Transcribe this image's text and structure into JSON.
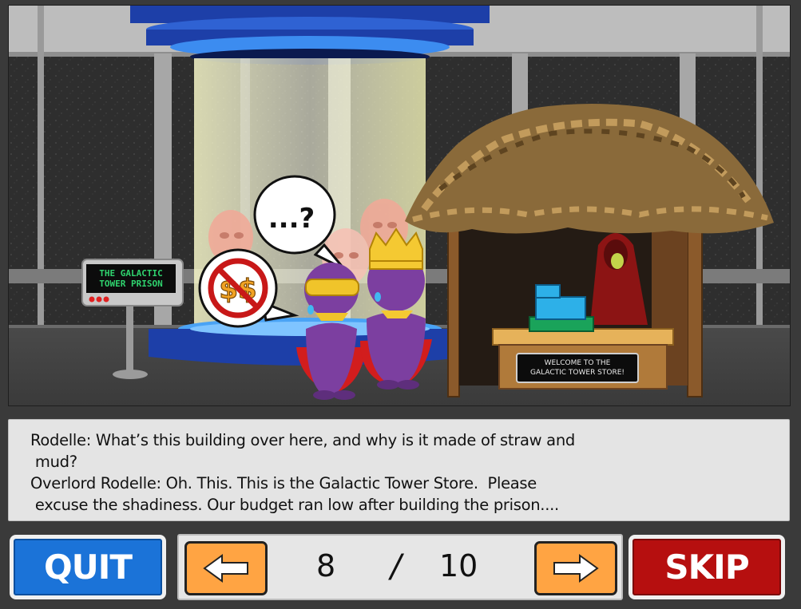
{
  "scene": {
    "prison_sign": [
      "THE GALACTIC",
      "TOWER PRISON"
    ],
    "thought_bubble": "...?",
    "store_sign": [
      "WELCOME TO THE",
      "GALACTIC TOWER STORE!"
    ]
  },
  "dialogue": {
    "lines": [
      "Rodelle: What’s this building over here, and why is it made of straw and",
      " mud?",
      "Overlord Rodelle: Oh. This. This is the Galactic Tower Store.  Please",
      " excuse the shadiness. Our budget ran low after building the prison...."
    ]
  },
  "controls": {
    "quit_label": "QUIT",
    "skip_label": "SKIP",
    "current_page": "8",
    "separator": "/",
    "total_pages": "10",
    "prev_icon": "arrow-left-icon",
    "next_icon": "arrow-right-icon"
  },
  "colors": {
    "quit": "#1b73d8",
    "skip": "#b60f0f",
    "arrow": "#ffa443"
  }
}
